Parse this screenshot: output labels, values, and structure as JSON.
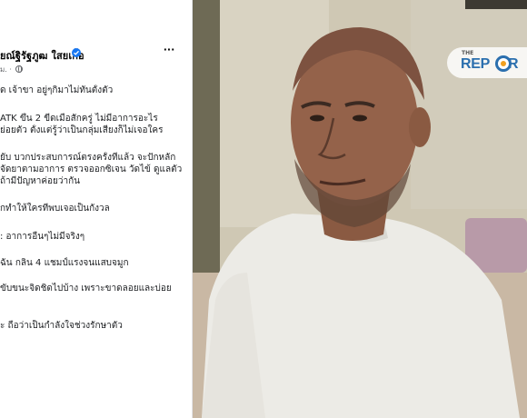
{
  "post": {
    "author": "ยณ์ฐิรัฐภูฒ ใสยเกื้อ",
    "meta": "ม. ·",
    "more_label": "···",
    "lines": [
      "ด เจ้าขา อยู่ๆกิมาไม่ทันตั้งตัว",
      "ATK ขึ้น 2 ขีดเมื่อสักครู่ ไม่มีอาการอะไร",
      "ย่อยตัว ตั้งแต่รู้ว่าเป็นกลุ่มเสี่ยงก็ไม่เจอใคร",
      "ยับ บวกประสบการณ์ตรงครั้งที่แล้ว จะปักหลัก",
      "จัดยาตามอาการ ตรวจออกซิเจน วัดไข้ ดูแลตัว",
      "ถ้ามีปัญหาค่อยว่ากัน",
      "กทำให้ใครที่พบเจอเป็นกังวล",
      ": อาการอื่นๆไม่มีจริงๆ",
      "ฉัน กลิ่น 4 แชมป์แรงจนแสบจมูก",
      "ขับขนะจิดชิดไปบ้าง เพราะขาดลอยและบ่อย",
      "ะ ถือว่าเป็นกำลังใจช่วงรักษาตัว"
    ]
  },
  "watermark": {
    "small": "THE",
    "big": "REPORTERS",
    "big_visible_prefix": "REP",
    "big_visible_suffix": "R"
  },
  "colors": {
    "facebook_blue": "#1877f2",
    "reporters_blue": "#2b6fae",
    "reporters_orange": "#f0a020"
  }
}
